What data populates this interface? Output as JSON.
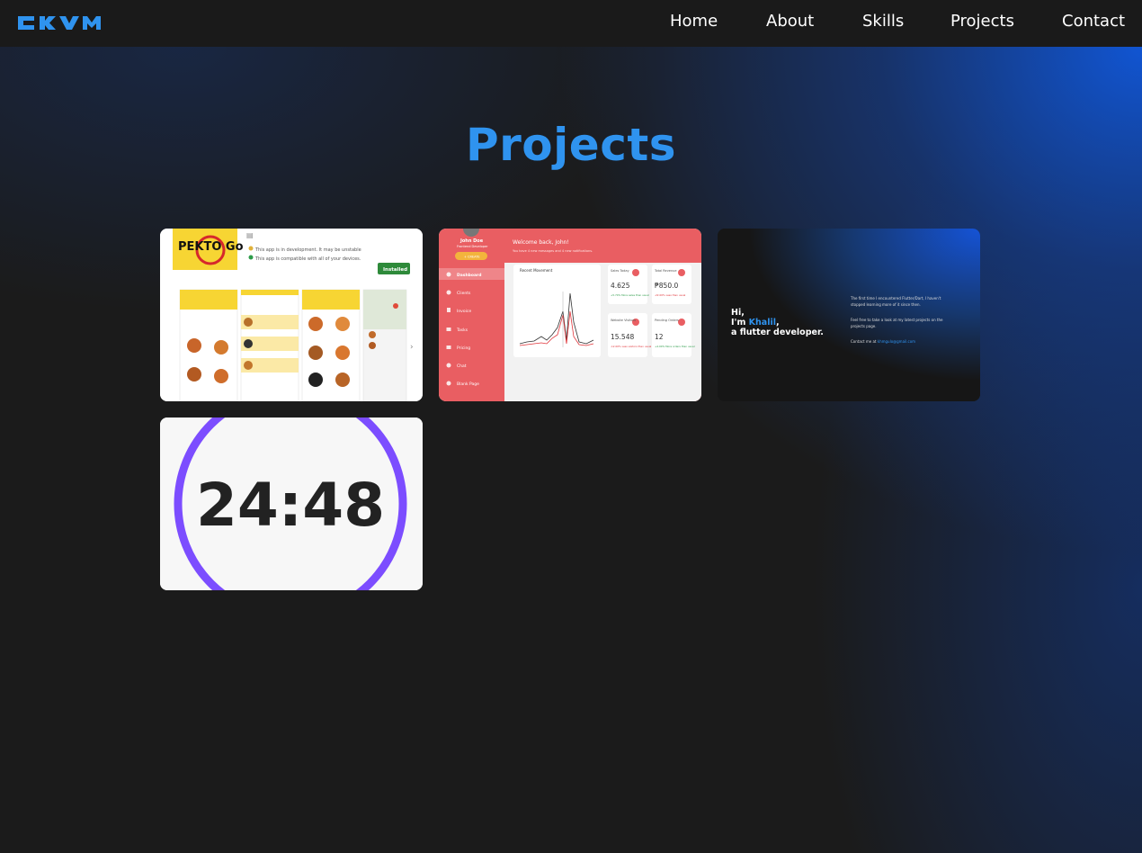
{
  "brand": {
    "logo_text": "CKVM",
    "logo_color": "#2f93ef"
  },
  "nav": {
    "items": [
      {
        "label": "Home"
      },
      {
        "label": "About"
      },
      {
        "label": "Skills"
      },
      {
        "label": "Projects"
      },
      {
        "label": "Contact"
      }
    ]
  },
  "page": {
    "title": "Projects",
    "accent_color": "#2f93ef"
  },
  "projects": [
    {
      "thumbnail": {
        "logo_text": "PEKTO Go",
        "status_lines": [
          "This app is in development. It may be unstable",
          "This app is compatible with all of your devices."
        ],
        "button_label": "Installed"
      }
    },
    {
      "thumbnail": {
        "user_name": "John Doe",
        "user_role": "Frontend Developer",
        "greeting": "Welcome back, John!",
        "subgreeting": "You have 4 new messages and 4 new notifications.",
        "menu": [
          "Dashboard",
          "Clients",
          "Invoice",
          "Tasks",
          "Pricing",
          "Chat",
          "Blank Page"
        ],
        "chart_title": "Recent Movement",
        "stats": [
          {
            "label": "Sales Today",
            "value": "4.625",
            "note": "+5.70% More sales than usual"
          },
          {
            "label": "Total Revenue",
            "value": "₱850.0",
            "note": "-22.00% Less than usual"
          },
          {
            "label": "Website Visitors",
            "value": "15.548",
            "note": "-12.00% Less visitors than usual"
          },
          {
            "label": "Pending Orders",
            "value": "12",
            "note": "+4.00% More orders than usual"
          }
        ]
      }
    },
    {
      "thumbnail": {
        "greeting_line1": "Hi,",
        "greeting_line2_prefix": "I'm ",
        "greeting_name": "Khalil",
        "greeting_line2_suffix": ",",
        "greeting_line3": "a flutter developer.",
        "body_line1": "The first time I encountered Flutter/Dart, I haven't",
        "body_line2": "stopped learning more of it since then.",
        "body_line3": "Feel free to take a look at my latest projects on the",
        "body_line4": "projects page.",
        "contact_prefix": "Contact me at ",
        "contact_email": "khmgulo@gmail.com"
      }
    },
    {
      "thumbnail": {
        "timer_text": "24:48",
        "ring_color": "#7c4dff"
      }
    }
  ]
}
